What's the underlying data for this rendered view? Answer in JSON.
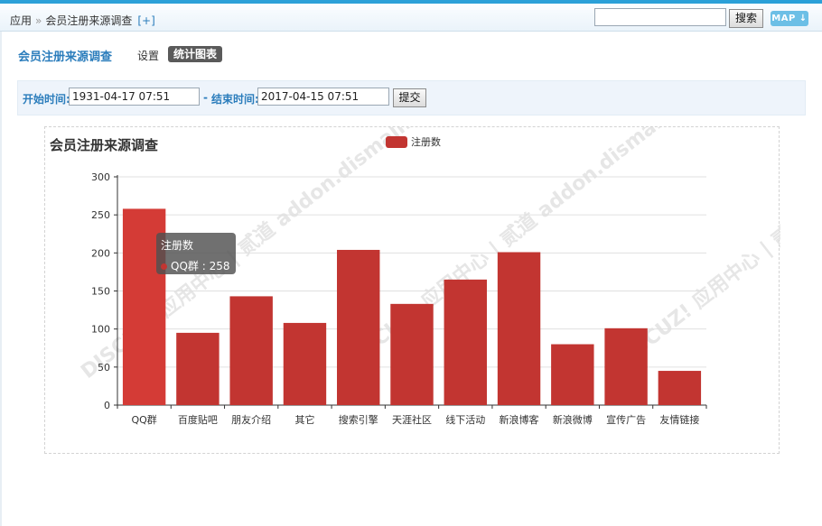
{
  "header": {
    "breadcrumb": {
      "root": "应用",
      "separator": "»",
      "current": "会员注册来源调查",
      "add_label": "[+]"
    },
    "search": {
      "value": "",
      "button_label": "搜索"
    },
    "map_label": "MAP ↓"
  },
  "page": {
    "title": "会员注册来源调查",
    "tabs": [
      {
        "label": "设置",
        "active": false
      },
      {
        "label": "统计图表",
        "active": true
      }
    ]
  },
  "filter": {
    "start_label": "开始时间:",
    "start_value": "1931-04-17 07:51",
    "separator": "-",
    "end_label": "结束时间:",
    "end_value": "2017-04-15 07:51",
    "submit_label": "提交"
  },
  "chart_data": {
    "type": "bar",
    "title": "会员注册来源调查",
    "categories": [
      "QQ群",
      "百度贴吧",
      "朋友介绍",
      "其它",
      "搜索引擎",
      "天涯社区",
      "线下活动",
      "新浪博客",
      "新浪微博",
      "宣传广告",
      "友情链接"
    ],
    "series": [
      {
        "name": "注册数",
        "values": [
          258,
          95,
          143,
          108,
          204,
          133,
          165,
          201,
          80,
          101,
          45
        ]
      }
    ],
    "ylim": [
      0,
      300
    ],
    "yticks": [
      0,
      50,
      100,
      150,
      200,
      250,
      300
    ],
    "grid": true,
    "legend_position": "top-center",
    "colors": {
      "bar": "#c23531",
      "bar_highlight": "#d43b36"
    }
  },
  "tooltip": {
    "series_name": "注册数",
    "category": "QQ群",
    "value": "258"
  },
  "watermark": "DISCUZ! 应用中心 | 贰道 addon.dismall.com"
}
